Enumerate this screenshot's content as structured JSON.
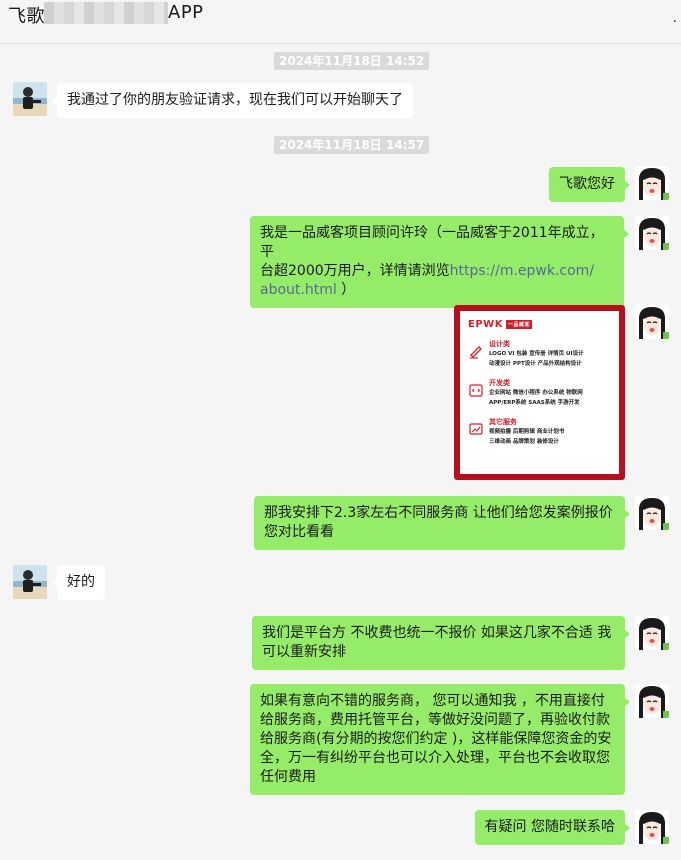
{
  "window": {
    "title_left": "飞歌",
    "title_right": "APP",
    "menu_glyph": "."
  },
  "timestamps": [
    "2024年11月18日 14:52",
    "2024年11月18日 14:57"
  ],
  "messages": [
    {
      "from": "contact",
      "text": "我通过了你的朋友验证请求，现在我们可以开始聊天了"
    },
    {
      "from": "me",
      "text": "飞歌您好"
    },
    {
      "from": "me",
      "line1": "我是一品威客项目顾问许玲（一品威客于2011年成立，平",
      "line2_prefix": "台超2000万用户，详情请浏览",
      "link_part1": "https://m.epwk.com/",
      "link_part2": "about.html",
      "line3_suffix": " ）"
    },
    {
      "from": "me",
      "type": "image",
      "description": "一品威客服务卡片"
    },
    {
      "from": "me",
      "line1": "那我安排下2.3家左右不同服务商  让他们给您发案例报价",
      "line2": "您对比看看"
    },
    {
      "from": "contact",
      "text": "好的"
    },
    {
      "from": "me",
      "line1": "我们是平台方 不收费也统一不报价  如果这几家不合适 我",
      "line2": "可以重新安排"
    },
    {
      "from": "me",
      "lines": [
        "如果有意向不错的服务商， 您可以通知我 ，不用直接付",
        "给服务商，费用托管平台，等做好没问题了，再验收付款",
        "给服务商(有分期的按您们约定 )，这样能保障您资金的安",
        "全，万一有纠纷平台也可以介入处理，平台也不会收取您",
        "任何费用"
      ]
    },
    {
      "from": "me",
      "text": "有疑问 您随时联系哈"
    }
  ],
  "card": {
    "logo": "EPWK",
    "logo_badge": "一品威客",
    "sections": [
      {
        "icon": "pen-icon",
        "heading": "设计类",
        "lines": [
          "LOGO  VI  包装  宣传册  详情页  UI设计",
          "动漫设计  PPT设计  产品外观结构设计"
        ]
      },
      {
        "icon": "code-icon",
        "heading": "开发类",
        "lines": [
          "企业网站  微信小程序  办公系统  物联网",
          "APP/ERP系统  SAAS系统  手游开发"
        ]
      },
      {
        "icon": "chart-icon",
        "heading": "其它服务",
        "lines": [
          "视频拍摄  后期剪辑  商业计划书",
          "三维动画  品牌策划  装修设计"
        ]
      }
    ]
  },
  "colors": {
    "background": "#f5f5f5",
    "bubble_out": "#95ec69",
    "bubble_in": "#ffffff",
    "timestamp_bg": "#dadada",
    "link": "#576b95",
    "card_frame": "#b80f1c"
  }
}
